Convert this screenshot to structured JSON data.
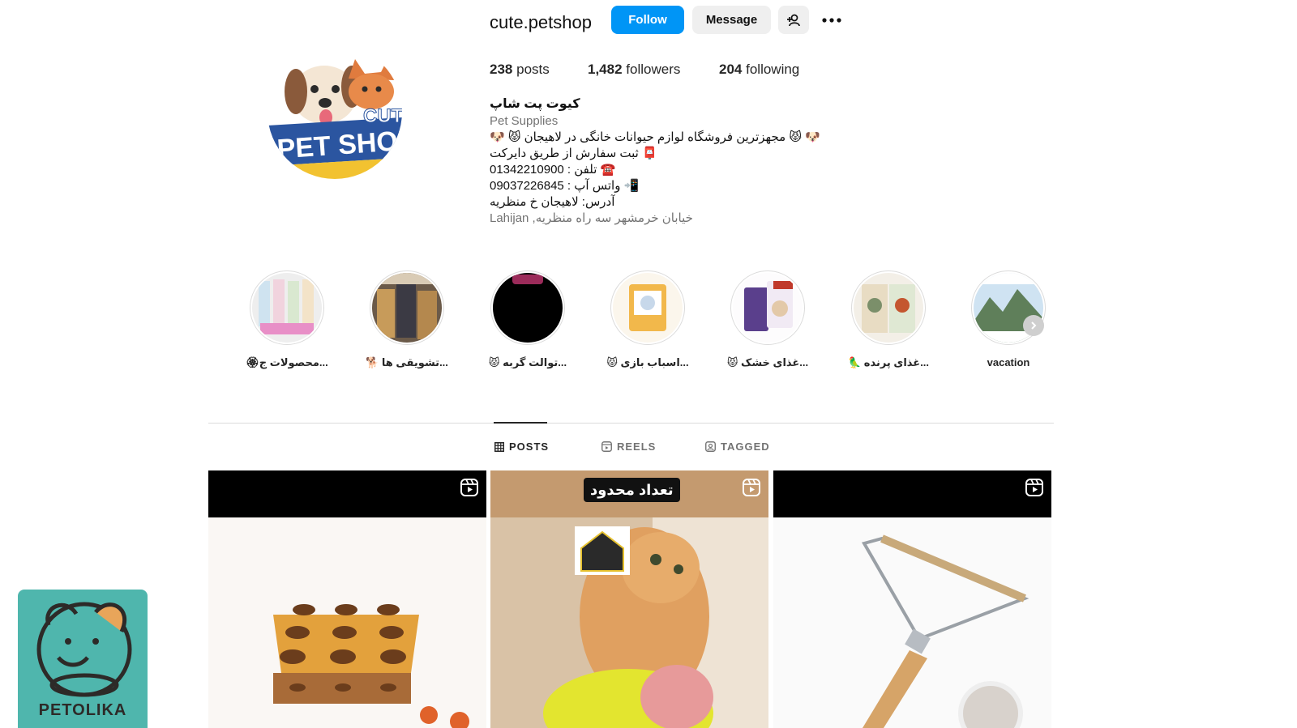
{
  "profile": {
    "username": "cute.petshop",
    "follow_label": "Follow",
    "message_label": "Message",
    "avatar_text": {
      "line1": "CUTE",
      "line2": "PET SHOP"
    },
    "stats": {
      "posts_count": "238",
      "posts_label": "posts",
      "followers_count": "1,482",
      "followers_label": "followers",
      "following_count": "204",
      "following_label": "following"
    },
    "bio": {
      "name": "کیوت پت شاپ",
      "category": "Pet Supplies",
      "line1": "🐶 😾 مجهزترین فروشگاه لوازم حیوانات خانگی در لاهیجان 😾 🐶",
      "line2": "📮 ثبت سفارش از طریق دایرکت",
      "line3": "☎️ تلفن : 01342210900",
      "line4": "📲 واتس آپ : 09037226845",
      "line5": "آدرس: لاهیجان خ منظریه",
      "address": "خیابان خرمشهر سه راه منظریه, Lahijan"
    }
  },
  "highlights": [
    {
      "label": "🏵محصولات ج..."
    },
    {
      "label": "🐕 تشویقی ها..."
    },
    {
      "label": "😾 توالت گربه..."
    },
    {
      "label": "😾 اسباب بازی..."
    },
    {
      "label": "😾 غذای خشک..."
    },
    {
      "label": "🦜 غذای پرنده..."
    },
    {
      "label": "vacation"
    }
  ],
  "tabs": {
    "posts": "POSTS",
    "reels": "REELS",
    "tagged": "TAGGED"
  },
  "posts": {
    "post2_caption": "تعداد محدود"
  },
  "watermark": {
    "text": "PETOLIKA"
  },
  "colors": {
    "follow_button": "#0095f6",
    "watermark_bg": "#4fb6ad"
  }
}
